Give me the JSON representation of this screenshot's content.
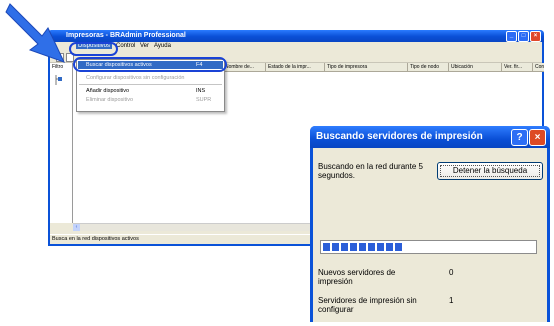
{
  "window": {
    "title": "Impresoras - BRAdmin Professional",
    "menu": [
      "Dispositivos",
      "Control",
      "Ver",
      "Ayuda"
    ],
    "filter_label": "Filtro",
    "columns": [
      "Nombre de...",
      "Estado de la impr...",
      "Tipo de impresora",
      "Tipo de nodo",
      "Ubicación",
      "Ver. fir...",
      "Contacto"
    ],
    "status": "Busca en la red dispositivos activos"
  },
  "dropdown": {
    "items": [
      {
        "label": "Buscar dispositivos activos",
        "shortcut": "F4",
        "state": "selected"
      },
      {
        "label": "Configurar dispositivos sin configuración",
        "shortcut": "",
        "state": "disabled"
      },
      {
        "label": "Añadir dispositivo",
        "shortcut": "INS",
        "state": "normal"
      },
      {
        "label": "Eliminar dispositivo",
        "shortcut": "SUPR",
        "state": "disabled"
      }
    ]
  },
  "dialog": {
    "title": "Buscando servidores de impresión",
    "searching_text": "Buscando en la red durante 5 segundos.",
    "stop_button": "Detener la búsqueda",
    "progress_blocks": 9,
    "new_servers_label": "Nuevos servidores de impresión",
    "new_servers_value": "0",
    "unconfigured_label": "Servidores de impresión sin configurar",
    "unconfigured_value": "1"
  },
  "colors": {
    "title_blue": "#0a52d8",
    "menu_highlight": "#316ac5",
    "arrow_blue": "#2f6fe8",
    "close_red": "#dd4a24"
  },
  "icons": [
    "arrow-pointer-icon",
    "minimize-icon",
    "maximize-icon",
    "close-icon",
    "help-icon",
    "tree-printer-icon"
  ]
}
